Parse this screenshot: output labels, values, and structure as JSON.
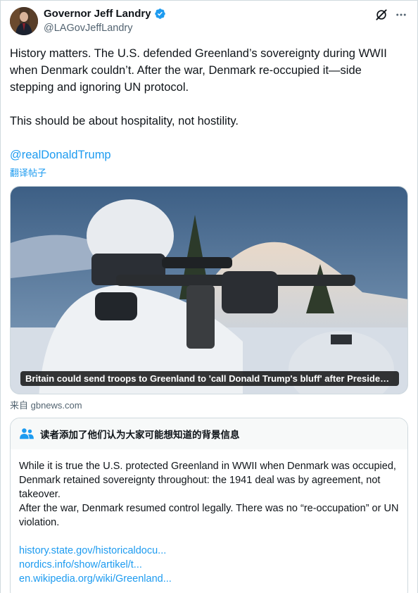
{
  "author": {
    "display_name": "Governor Jeff Landry",
    "handle": "@LAGovJeffLandry",
    "avatar_icon": "avatar-photo",
    "verified_icon": "verified-badge-icon",
    "verified_color": "#1d9bf0"
  },
  "header_actions": {
    "grok_icon": "grok-icon",
    "more_icon": "more-options-icon"
  },
  "tweet": {
    "para1": "History matters. The U.S. defended Greenland’s sovereignty during WWII when Denmark couldn’t. After the war, Denmark re-occupied it—side stepping and ignoring UN protocol.",
    "para2": "This should be about hospitality, not hostility.",
    "mention": "@realDonaldTrump",
    "translate_label": "翻译帖子"
  },
  "link_card": {
    "title": "Britain could send troops to Greenland to 'call Donald Trump's bluff' after President's t...",
    "source": "来自 gbnews.com"
  },
  "community_note": {
    "icon": "people-icon",
    "header": "读者添加了他们认为大家可能想知道的背景信息",
    "body1": "While it is true the U.S. protected Greenland in WWII when Denmark was occupied, Denmark retained sovereignty throughout: the 1941 deal was by agreement, not takeover.",
    "body2": "After the war, Denmark resumed control legally. There was no “re-occupation” or UN violation.",
    "links": [
      "history.state.gov/historicaldocu...",
      "nordics.info/show/artikel/t...",
      "en.wikipedia.org/wiki/Greenland..."
    ]
  },
  "colors": {
    "accent": "#1d9bf0",
    "text": "#0f1419",
    "secondary": "#536471",
    "border": "#cfd9de"
  }
}
